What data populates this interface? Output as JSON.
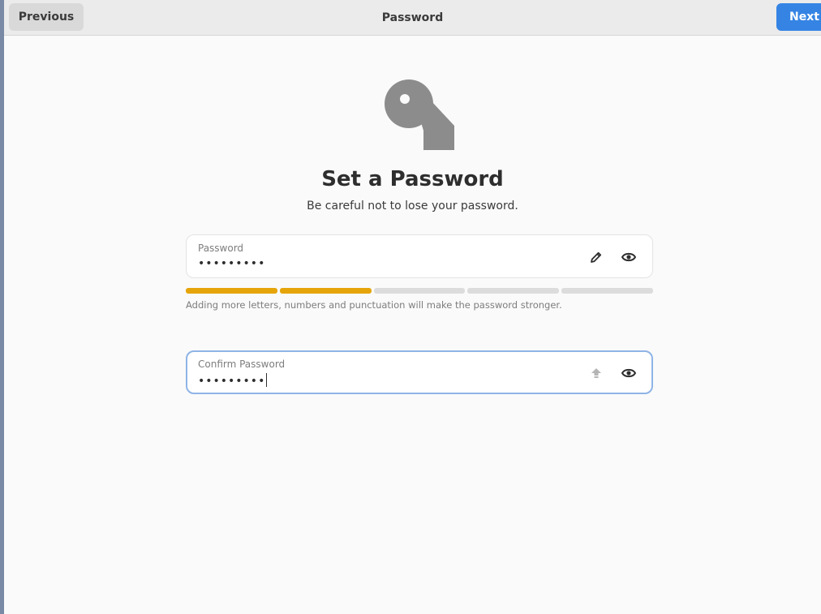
{
  "header": {
    "previous_label": "Previous",
    "title": "Password",
    "next_label": "Next"
  },
  "page": {
    "heading": "Set a Password",
    "subtitle": "Be careful not to lose your password.",
    "icon": "key-icon"
  },
  "password_field": {
    "label": "Password",
    "value": "•••••••••",
    "edit_icon": "pencil-icon",
    "reveal_icon": "eye-icon"
  },
  "strength": {
    "segments_total": 5,
    "segments_filled": 2,
    "color": "#e5a50a",
    "hint": "Adding more letters, numbers and punctuation will make the password stronger."
  },
  "confirm_field": {
    "label": "Confirm Password",
    "value": "•••••••••",
    "caps_icon": "caps-lock-icon",
    "reveal_icon": "eye-icon"
  },
  "colors": {
    "accent": "#3584e4",
    "strength_fill": "#e5a50a"
  }
}
